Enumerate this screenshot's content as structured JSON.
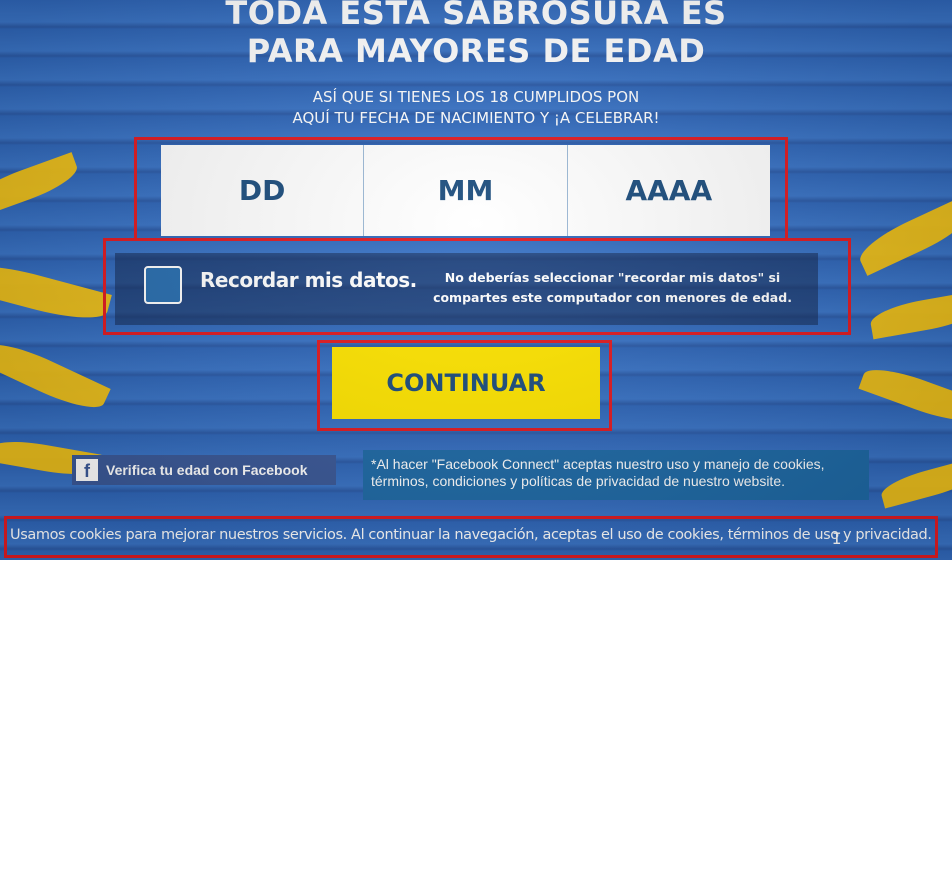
{
  "age_gate": {
    "heading_line1": "TODA ESTA SABROSURA ES",
    "heading_line2": "PARA MAYORES DE EDAD",
    "sub_line1": "ASÍ QUE SI TIENES LOS 18 CUMPLIDOS PON",
    "sub_line2": "AQUÍ TU FECHA DE NACIMIENTO Y ¡A CELEBRAR!",
    "date_fields": {
      "day": "DD",
      "month": "MM",
      "year": "AAAA"
    },
    "remember": {
      "label": "Recordar mis datos.",
      "warning": "No deberías seleccionar \"recordar mis datos\" si compartes este computador con menores de edad.",
      "checked": false
    },
    "continue_label": "CONTINUAR",
    "facebook": {
      "button_label": "Verifica tu edad con Facebook",
      "icon": "facebook-icon",
      "notice": "*Al hacer \"Facebook Connect\" aceptas nuestro uso y manejo de cookies, términos, condiciones y políticas de privacidad de nuestro website."
    },
    "cookie_notice": "Usamos cookies para mejorar nuestros servicios. Al continuar la navegación, aceptas el uso de cookies, términos de uso y privacidad."
  },
  "colors": {
    "background_blue": "#2f66b8",
    "accent_yellow": "#ffe500",
    "text_navy": "#1d4e7e",
    "highlight_red": "#e01b22",
    "facebook_blue": "#3b5998"
  }
}
